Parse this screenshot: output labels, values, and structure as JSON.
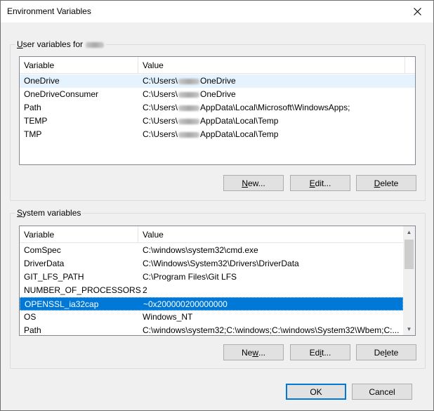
{
  "window": {
    "title": "Environment Variables"
  },
  "user_group": {
    "label_prefix": "User variables for ",
    "columns": [
      "Variable",
      "Value"
    ],
    "rows": [
      {
        "name": "OneDrive",
        "value_pre": "C:\\Users\\",
        "value_post": "OneDrive"
      },
      {
        "name": "OneDriveConsumer",
        "value_pre": "C:\\Users\\",
        "value_post": "OneDrive"
      },
      {
        "name": "Path",
        "value_pre": "C:\\Users\\",
        "value_post": "AppData\\Local\\Microsoft\\WindowsApps;"
      },
      {
        "name": "TEMP",
        "value_pre": "C:\\Users\\",
        "value_post": "AppData\\Local\\Temp"
      },
      {
        "name": "TMP",
        "value_pre": "C:\\Users\\",
        "value_post": "AppData\\Local\\Temp"
      }
    ],
    "buttons": {
      "new": {
        "mnemonic": "N",
        "rest": "ew..."
      },
      "edit": {
        "mnemonic": "E",
        "rest": "dit..."
      },
      "delete": {
        "mnemonic": "D",
        "rest": "elete"
      }
    }
  },
  "system_group": {
    "label_mnemonic": "S",
    "label_rest": "ystem variables",
    "columns": [
      "Variable",
      "Value"
    ],
    "rows": [
      {
        "name": "ComSpec",
        "value": "C:\\windows\\system32\\cmd.exe"
      },
      {
        "name": "DriverData",
        "value": "C:\\Windows\\System32\\Drivers\\DriverData"
      },
      {
        "name": "GIT_LFS_PATH",
        "value": "C:\\Program Files\\Git LFS"
      },
      {
        "name": "NUMBER_OF_PROCESSORS",
        "value": "2"
      },
      {
        "name": "OPENSSL_ia32cap",
        "value": "~0x200000200000000"
      },
      {
        "name": "OS",
        "value": "Windows_NT"
      },
      {
        "name": "Path",
        "value": "C:\\windows\\system32;C:\\windows;C:\\windows\\System32\\Wbem;C:..."
      }
    ],
    "buttons": {
      "new": {
        "pre": "Ne",
        "mnemonic": "w",
        "rest": "..."
      },
      "edit": {
        "pre": "Ed",
        "mnemonic": "i",
        "rest": "t..."
      },
      "delete": {
        "pre": "De",
        "mnemonic": "l",
        "rest": "ete"
      }
    }
  },
  "footer": {
    "ok_label": "OK",
    "cancel_label": "Cancel"
  },
  "colors": {
    "selection": "#0078d7",
    "hover": "#e5f3ff"
  }
}
